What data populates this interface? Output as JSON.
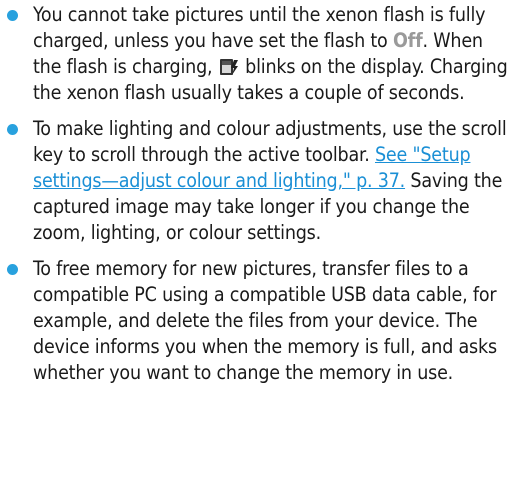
{
  "bullets": [
    {
      "t1": "You cannot take pictures until the xenon flash is fully charged, unless you have set the flash to ",
      "kw": "Off",
      "t2": ". When the flash is charging, ",
      "icon": "flash-charging-icon",
      "t3": " blinks on the display. Charging the xenon flash usually takes a couple of seconds."
    },
    {
      "t1": "To make lighting and colour adjustments, use the scroll key to scroll through the active toolbar. ",
      "link": "See \"Setup settings—adjust colour and lighting,\" p. 37.",
      "t2": " Saving the captured image may take longer if you change the zoom, lighting, or colour settings."
    },
    {
      "t1": "To free memory for new pictures, transfer files to a compatible PC using a compatible USB data cable, for example, and delete the files from your device. The device informs you when the memory is full, and asks whether you want to change the memory in use."
    }
  ],
  "colors": {
    "bullet": "#28a1de",
    "link": "#1a8fd5",
    "keyword": "#9a9a9a",
    "text": "#1a1a1a"
  }
}
